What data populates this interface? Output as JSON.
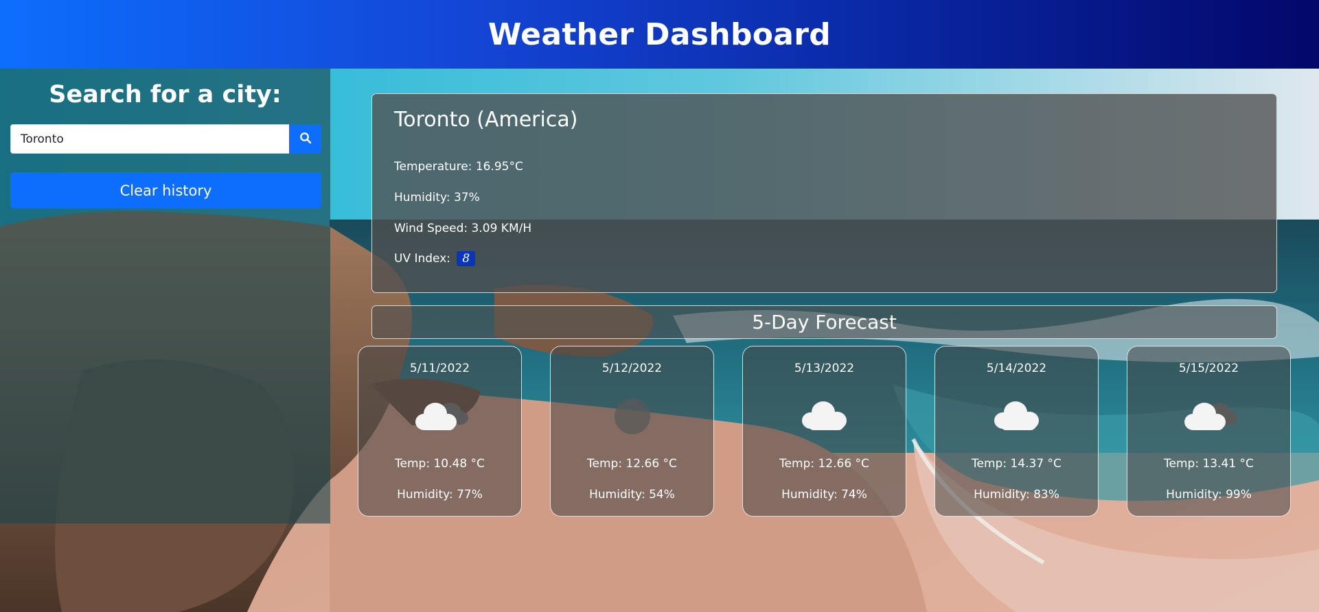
{
  "header": {
    "title": "Weather Dashboard"
  },
  "sidebar": {
    "title": "Search for a city:",
    "search_value": "Toronto",
    "search_icon": "search-icon",
    "clear_label": "Clear history"
  },
  "current": {
    "city": "Toronto (America)",
    "temperature": "Temperature: 16.95°C",
    "humidity": "Humidity: 37%",
    "wind": "Wind Speed: 3.09 KM/H",
    "uv_label": "UV Index:",
    "uv_value": "8"
  },
  "forecast": {
    "title": "5-Day Forecast",
    "days": [
      {
        "date": "5/11/2022",
        "icon": "broken-clouds-icon",
        "temp": "Temp: 10.48 °C",
        "humidity": "Humidity: 77%"
      },
      {
        "date": "5/12/2022",
        "icon": "missing-weather-icon",
        "temp": "Temp: 12.66 °C",
        "humidity": "Humidity: 54%"
      },
      {
        "date": "5/13/2022",
        "icon": "cloud-icon",
        "temp": "Temp: 12.66 °C",
        "humidity": "Humidity: 74%"
      },
      {
        "date": "5/14/2022",
        "icon": "cloud-icon",
        "temp": "Temp: 14.37 °C",
        "humidity": "Humidity: 83%"
      },
      {
        "date": "5/15/2022",
        "icon": "broken-clouds-icon",
        "temp": "Temp: 13.41 °C",
        "humidity": "Humidity: 99%"
      }
    ]
  },
  "colors": {
    "primary": "#0d6efd",
    "header_start": "#0d6efd",
    "header_end": "#03076a",
    "uv_badge": "#0a35b8"
  }
}
